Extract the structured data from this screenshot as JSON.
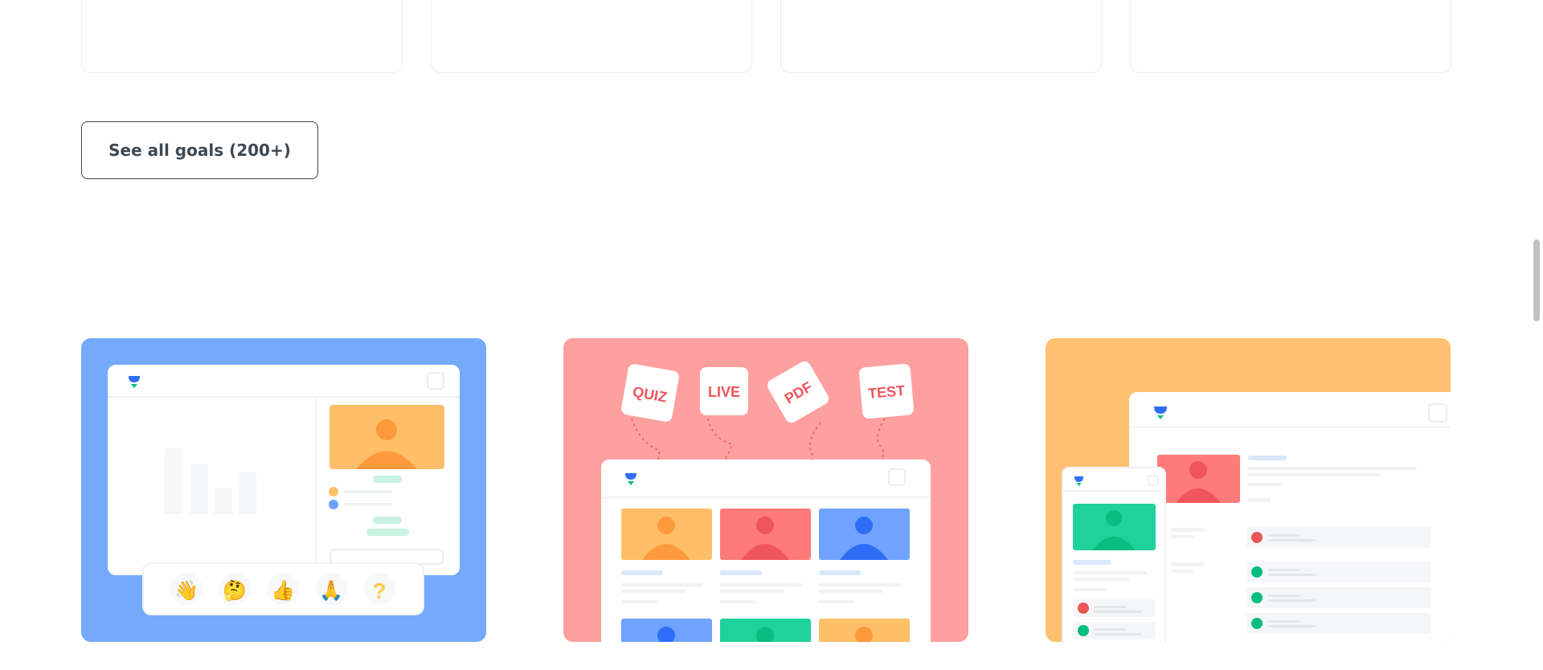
{
  "goals": {
    "see_all_label": "See all goals (200+)"
  },
  "features": [
    {
      "name": "live-class",
      "bg": "#74a9fc",
      "reactions": [
        "👋",
        "🤔",
        "👍",
        "🙏",
        "?"
      ]
    },
    {
      "name": "practice",
      "bg": "#fda09f",
      "tags": [
        "QUIZ",
        "LIVE",
        "PDF",
        "TEST"
      ]
    },
    {
      "name": "devices",
      "bg": "#fdc170"
    }
  ],
  "colors": {
    "brand_blue": "#2f6df6",
    "brand_green": "#08bd80",
    "avatar_orange": "#ffbf69",
    "avatar_red": "#ff7a7a",
    "avatar_blue": "#6fa3ff",
    "avatar_green": "#1fd19a",
    "tag_text": "#f0555c"
  }
}
